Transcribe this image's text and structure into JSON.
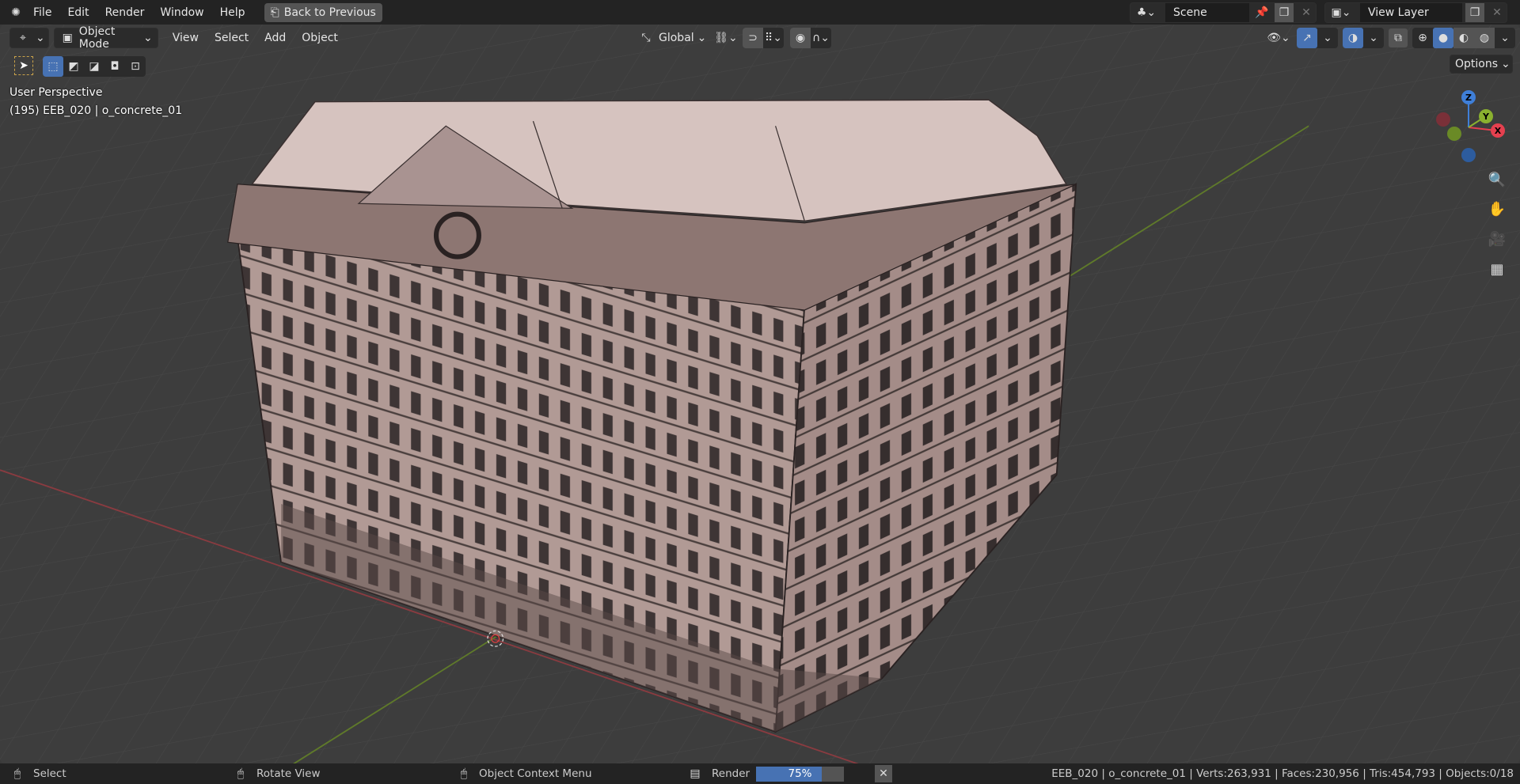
{
  "topbar": {
    "menus": [
      "File",
      "Edit",
      "Render",
      "Window",
      "Help"
    ],
    "back_button": "Back to Previous",
    "scene": "Scene",
    "view_layer": "View Layer"
  },
  "header": {
    "mode": "Object Mode",
    "menus": [
      "View",
      "Select",
      "Add",
      "Object"
    ],
    "transform_orientation": "Global",
    "options": "Options"
  },
  "viewport": {
    "view_name": "User Perspective",
    "object_info": "(195) EEB_020 | o_concrete_01",
    "gizmo": {
      "z": "Z",
      "y": "Y",
      "x": "X"
    }
  },
  "status": {
    "select": "Select",
    "rotate": "Rotate View",
    "context": "Object Context Menu",
    "render_label": "Render",
    "render_progress_text": "75%",
    "render_progress": 0.75,
    "stats": "EEB_020 | o_concrete_01 | Verts:263,931 | Faces:230,956 | Tris:454,793 | Objects:0/18"
  },
  "colors": {
    "accent": "#4772b3",
    "x_axis": "#e5404f",
    "y_axis": "#8ab12f",
    "z_axis": "#3f7fd8",
    "model": "#b39c97"
  }
}
